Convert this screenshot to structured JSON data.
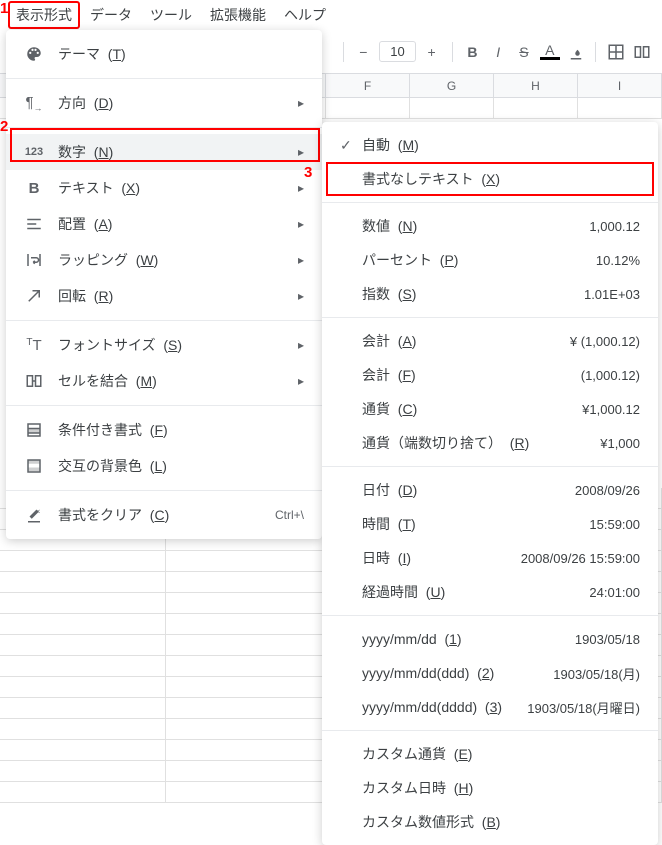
{
  "menubar": {
    "items": [
      "表示形式",
      "データ",
      "ツール",
      "拡張機能",
      "ヘルプ"
    ]
  },
  "toolbar": {
    "fontsize": "10"
  },
  "columns": [
    "F",
    "G",
    "H",
    "I"
  ],
  "format_menu": {
    "items": [
      {
        "icon": "palette",
        "label": "テーマ",
        "shortcut_u": "T"
      },
      {
        "sep": true
      },
      {
        "icon": "pilcrow",
        "label": "方向",
        "shortcut_u": "D",
        "arrow": true
      },
      {
        "sep": true
      },
      {
        "icon": "123",
        "label": "数字",
        "shortcut_u": "N",
        "arrow": true,
        "hover": true
      },
      {
        "icon": "B",
        "label": "テキスト",
        "shortcut_u": "X",
        "arrow": true
      },
      {
        "icon": "align",
        "label": "配置",
        "shortcut_u": "A",
        "arrow": true
      },
      {
        "icon": "wrap",
        "label": "ラッピング",
        "shortcut_u": "W",
        "arrow": true
      },
      {
        "icon": "rotate",
        "label": "回転",
        "shortcut_u": "R",
        "arrow": true
      },
      {
        "sep": true
      },
      {
        "icon": "tT",
        "label": "フォントサイズ",
        "shortcut_u": "S",
        "arrow": true
      },
      {
        "icon": "merge",
        "label": "セルを結合",
        "shortcut_u": "M",
        "arrow": true
      },
      {
        "sep": true
      },
      {
        "icon": "cond",
        "label": "条件付き書式",
        "shortcut_u": "F"
      },
      {
        "icon": "alt",
        "label": "交互の背景色",
        "shortcut_u": "L"
      },
      {
        "sep": true
      },
      {
        "icon": "clear",
        "label": "書式をクリア",
        "shortcut_u": "C",
        "shortcut": "Ctrl+\\"
      }
    ]
  },
  "number_submenu": {
    "items": [
      {
        "checked": true,
        "label": "自動",
        "shortcut_u": "M"
      },
      {
        "label": "書式なしテキスト",
        "shortcut_u": "X",
        "highlight": true
      },
      {
        "sep": true
      },
      {
        "label": "数値",
        "shortcut_u": "N",
        "sample": "1,000.12"
      },
      {
        "label": "パーセント",
        "shortcut_u": "P",
        "sample": "10.12%"
      },
      {
        "label": "指数",
        "shortcut_u": "S",
        "sample": "1.01E+03"
      },
      {
        "sep": true
      },
      {
        "label": "会計",
        "shortcut_u": "A",
        "sample": "¥ (1,000.12)"
      },
      {
        "label": "会計",
        "shortcut_u": "F",
        "sample": "(1,000.12)"
      },
      {
        "label": "通貨",
        "shortcut_u": "C",
        "sample": "¥1,000.12"
      },
      {
        "label": "通貨（端数切り捨て）",
        "shortcut_u": "R",
        "sample": "¥1,000"
      },
      {
        "sep": true
      },
      {
        "label": "日付",
        "shortcut_u": "D",
        "sample": "2008/09/26"
      },
      {
        "label": "時間",
        "shortcut_u": "T",
        "sample": "15:59:00"
      },
      {
        "label": "日時",
        "shortcut_u": "I",
        "sample": "2008/09/26 15:59:00"
      },
      {
        "label": "経過時間",
        "shortcut_u": "U",
        "sample": "24:01:00"
      },
      {
        "sep": true
      },
      {
        "label": "yyyy/mm/dd",
        "shortcut_u": "1",
        "sample": "1903/05/18"
      },
      {
        "label": "yyyy/mm/dd(ddd)",
        "shortcut_u": "2",
        "sample": "1903/05/18(月)"
      },
      {
        "label": "yyyy/mm/dd(dddd)",
        "shortcut_u": "3",
        "sample": "1903/05/18(月曜日)"
      },
      {
        "sep": true
      },
      {
        "label": "カスタム通貨",
        "shortcut_u": "E"
      },
      {
        "label": "カスタム日時",
        "shortcut_u": "H"
      },
      {
        "label": "カスタム数値形式",
        "shortcut_u": "B"
      }
    ]
  },
  "callouts": {
    "c1": "1",
    "c2": "2",
    "c3": "3"
  }
}
